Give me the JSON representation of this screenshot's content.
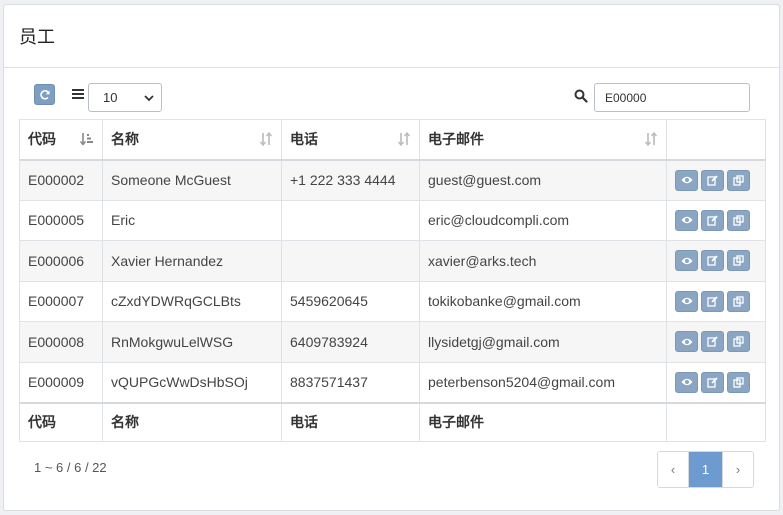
{
  "panel": {
    "title": "员工"
  },
  "toolbar": {
    "page_size": "10",
    "search_value": "E00000",
    "refresh_icon": "refresh-icon",
    "columns_icon": "menu-icon",
    "search_icon": "search-icon"
  },
  "table": {
    "columns": [
      "代码",
      "名称",
      "电话",
      "电子邮件"
    ],
    "rows": [
      {
        "code": "E000002",
        "name": "Someone McGuest",
        "phone": "+1 222 333 4444",
        "email": "guest@guest.com"
      },
      {
        "code": "E000005",
        "name": "Eric",
        "phone": "",
        "email": "eric@cloudcompli.com"
      },
      {
        "code": "E000006",
        "name": "Xavier Hernandez",
        "phone": "",
        "email": "xavier@arks.tech"
      },
      {
        "code": "E000007",
        "name": "cZxdYDWRqGCLBts",
        "phone": "5459620645",
        "email": "tokikobanke@gmail.com"
      },
      {
        "code": "E000008",
        "name": "RnMokgwuLelWSG",
        "phone": "6409783924",
        "email": "llysidetgj@gmail.com"
      },
      {
        "code": "E000009",
        "name": "vQUPGcWwDsHbSOj",
        "phone": "8837571437",
        "email": "peterbenson5204@gmail.com"
      }
    ],
    "row_actions": [
      "view-icon",
      "edit-icon",
      "copy-icon"
    ]
  },
  "footer": {
    "summary": "1 ~ 6 / 6 / 22",
    "pager": {
      "prev": "‹",
      "current": "1",
      "next": "›"
    }
  },
  "colors": {
    "accent": "#6e9bcf",
    "action_button": "#8aa6c2"
  }
}
